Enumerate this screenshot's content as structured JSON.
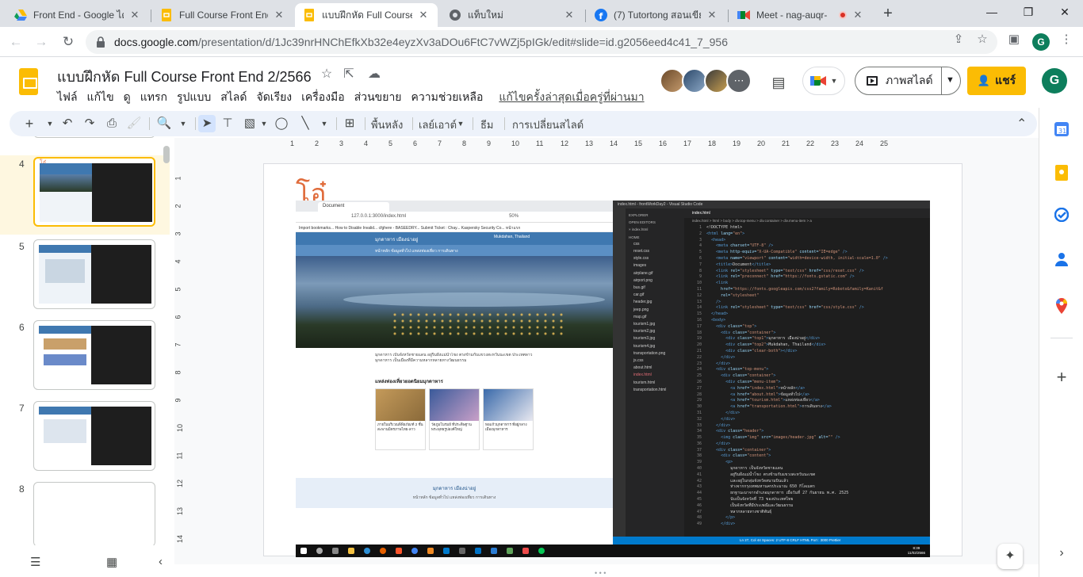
{
  "browser": {
    "tabs": [
      {
        "title": "Front End - Google ไดรฟ์",
        "icon": "google-drive-icon"
      },
      {
        "title": "Full Course Front End",
        "icon": "slides-icon"
      },
      {
        "title": "แบบฝึกหัด Full Course F",
        "icon": "slides-icon",
        "active": true
      },
      {
        "title": "แท็บใหม่",
        "icon": "chrome-icon"
      },
      {
        "title": "(7) Tutortong สอนเขียนโ",
        "icon": "facebook-icon"
      },
      {
        "title": "Meet - nag-auqr-",
        "icon": "meet-icon"
      }
    ],
    "url_host": "docs.google.com",
    "url_path": "/presentation/d/1Jc39nrHNChEfkXb32e4eyzXv3aDOu6FtC7vWZj5pIGk/edit#slide=id.g2056eed4c41_7_956",
    "profile_initial": "G"
  },
  "app": {
    "title": "แบบฝึกหัด Full Course Front End 2/2566",
    "menu": [
      "ไฟล์",
      "แก้ไข",
      "ดู",
      "แทรก",
      "รูปแบบ",
      "สไลด์",
      "จัดเรียง",
      "เครื่องมือ",
      "ส่วนขยาย",
      "ความช่วยเหลือ"
    ],
    "last_edit": "แก้ไขครั้งล่าสุดเมื่อครู่ที่ผ่านมา",
    "slideshow_label": "ภาพสไลด์",
    "share_label": "แชร์",
    "profile_initial": "G"
  },
  "toolbar": {
    "background_label": "พื้นหลัง",
    "layout_label": "เลย์เอาต์",
    "theme_label": "ธีม",
    "transition_label": "การเปลี่ยนสไลด์"
  },
  "filmstrip": {
    "slides": [
      {
        "num": "4",
        "selected": true
      },
      {
        "num": "5"
      },
      {
        "num": "6"
      },
      {
        "num": "7"
      },
      {
        "num": "8"
      }
    ]
  },
  "ruler": {
    "h": [
      "1",
      "2",
      "3",
      "4",
      "5",
      "6",
      "7",
      "8",
      "9",
      "10",
      "11",
      "12",
      "13",
      "14",
      "15",
      "16",
      "17",
      "18",
      "19",
      "20",
      "21",
      "22",
      "23",
      "24",
      "25"
    ],
    "v": [
      "1",
      "2",
      "3",
      "4",
      "5",
      "6",
      "7",
      "8",
      "9",
      "10",
      "11",
      "12",
      "13",
      "14"
    ]
  },
  "slide": {
    "title": "โอ๋",
    "inner_browser": {
      "tab": "Document",
      "address": "127.0.0.1:3000/index.html",
      "zoom": "50%",
      "bookmarks": "Import bookmarks...   How to Disable Invalid...   cfghere - BASEEDRY...   Submit Ticket : Chay...   Kaspersky Security Co...   หน้าแรก",
      "site_title": "มุกดาหาร เมืองน่าอยู่",
      "site_sub": "Mukdahan, Thailand",
      "site_menu": "หน้าหลัก   ข้อมูลทั่วไป   แหล่งท่องเที่ยว   การเดินทาง",
      "body_text": "มุกดาหาร เป็นจังหวัดชายแดน อยู่ริมฝั่งแม่น้ำโขง ตรงข้ามกับแขวงสะหวันนะเขต ประเทศลาว มุกดาหาร เป็นเมืองที่มีความหลากหลายทางวัฒนธรรม",
      "section_title": "แหล่งท่องเที่ยวยอดนิยมมุกดาหาร",
      "cards": [
        "ภายในบริเวณพิพิธภัณฑ์ 2 ชั้น สะพานมิตรภาพไทย-ลาว",
        "วัดภูมโนรมย์ ที่ประดิษฐานพระพุทธรูปองค์ใหญ่",
        "หอแก้วมุกดาหาร ที่อยู่กลางเมืองมุกดาหาร"
      ],
      "footer_title": "มุกดาหาร เมืองน่าอยู่",
      "footer_sub": "หน้าหลัก   ข้อมูลทั่วไป   แหล่งท่องเที่ยว   การเดินทาง"
    },
    "vscode": {
      "title": "index.html - frontWorkDay2 - Visual Studio Code",
      "tab": "index.html",
      "crumb": "index.html > html > body > div.top-menu > div.container > div.menu-item > a",
      "explorer": [
        "EXPLORER",
        "OPEN EDITORS",
        "× index.html",
        "HOME",
        "css",
        "reset.css",
        "style.css",
        "images",
        "airplane.gif",
        "airport.png",
        "bus.gif",
        "car.gif",
        "header.jpg",
        "jeep.png",
        "map.gif",
        "tourism1.jpg",
        "tourism2.jpg",
        "tourism3.jpg",
        "tourism4.jpg",
        "transportation.png",
        "js.css",
        "about.html",
        "index.html",
        "tourism.html",
        "transportation.html"
      ],
      "status": "Ln 27, Col 44   Spaces: 2   UTF-8   CRLF   HTML   Port : 3000   Prettier",
      "clock_time": "8:39",
      "clock_date": "11/02/2566"
    }
  }
}
